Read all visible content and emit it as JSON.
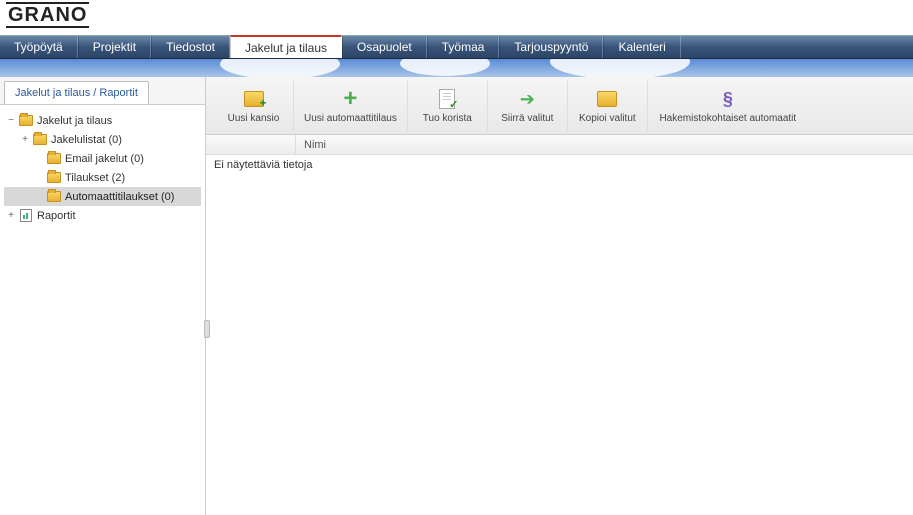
{
  "brand": "GRANO",
  "nav": {
    "items": [
      {
        "label": "Työpöytä",
        "active": false
      },
      {
        "label": "Projektit",
        "active": false
      },
      {
        "label": "Tiedostot",
        "active": false
      },
      {
        "label": "Jakelut ja tilaus",
        "active": true
      },
      {
        "label": "Osapuolet",
        "active": false
      },
      {
        "label": "Työmaa",
        "active": false
      },
      {
        "label": "Tarjouspyyntö",
        "active": false
      },
      {
        "label": "Kalenteri",
        "active": false
      }
    ]
  },
  "sidebar": {
    "tab_label": "Jakelut ja tilaus / Raportit",
    "tree": {
      "root1": {
        "label": "Jakelut ja tilaus",
        "expanded": true
      },
      "jakelulistat": {
        "label": "Jakelulistat (0)"
      },
      "email_jakelut": {
        "label": "Email jakelut (0)"
      },
      "tilaukset": {
        "label": "Tilaukset (2)"
      },
      "automaatti": {
        "label": "Automaattitilaukset (0)",
        "selected": true
      },
      "root2": {
        "label": "Raportit",
        "expanded": false
      }
    }
  },
  "toolbar": {
    "uusi_kansio": "Uusi kansio",
    "uusi_auto": "Uusi automaattitilaus",
    "tuo_korista": "Tuo korista",
    "siirra": "Siirrä valitut",
    "kopioi": "Kopioi valitut",
    "hakemisto": "Hakemistokohtaiset automaatit"
  },
  "grid": {
    "col_name": "Nimi",
    "empty_text": "Ei näytettäviä tietoja"
  }
}
